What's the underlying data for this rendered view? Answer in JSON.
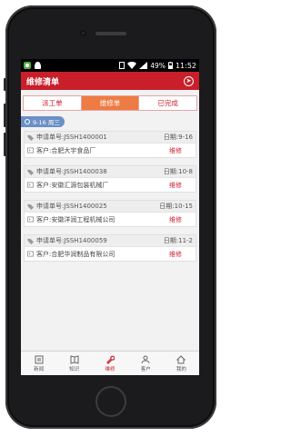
{
  "status_bar": {
    "battery": "49%",
    "time": "11:52"
  },
  "app": {
    "title": "维修清单"
  },
  "tabs": [
    {
      "label": "派工单",
      "active": false
    },
    {
      "label": "维修单",
      "active": true
    },
    {
      "label": "已完成",
      "active": false
    }
  ],
  "date_chip": {
    "label": "9-16 周三"
  },
  "orders": [
    {
      "request_label": "申请单号:",
      "request_no": "JSSH1400001",
      "date_label": "日期:",
      "date": "9-16",
      "customer_label": "客户:",
      "customer": "合肥大宇食品厂",
      "status": "维修"
    },
    {
      "request_label": "申请单号:",
      "request_no": "JSSH1400038",
      "date_label": "日期:",
      "date": "10-8",
      "customer_label": "客户:",
      "customer": "安徽汇源包装机械厂",
      "status": "维修"
    },
    {
      "request_label": "申请单号:",
      "request_no": "JSSH1400025",
      "date_label": "日期:",
      "date": "10-15",
      "customer_label": "客户:",
      "customer": "安徽洋润工程机械公司",
      "status": "维修"
    },
    {
      "request_label": "申请单号:",
      "request_no": "JSSH1400059",
      "date_label": "日期:",
      "date": "11-2",
      "customer_label": "客户:",
      "customer": "合肥华润制品有限公司",
      "status": "维修"
    }
  ],
  "bottom_nav": [
    {
      "label": "新闻",
      "icon": "news-icon",
      "active": false
    },
    {
      "label": "知识",
      "icon": "book-icon",
      "active": false
    },
    {
      "label": "维修",
      "icon": "wrench-icon",
      "active": true
    },
    {
      "label": "客户",
      "icon": "person-icon",
      "active": false
    },
    {
      "label": "我的",
      "icon": "home-icon",
      "active": false
    }
  ],
  "colors": {
    "brand_red": "#c81f2a",
    "tab_active": "#ee7b43",
    "date_chip": "#6b8fc6"
  }
}
